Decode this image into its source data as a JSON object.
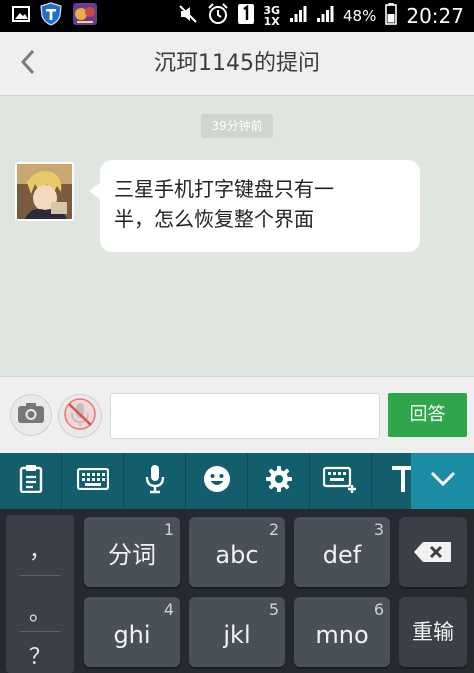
{
  "status_bar": {
    "net_top": "3G",
    "net_bottom": "1X",
    "battery": "48%",
    "time": "20:27"
  },
  "titlebar": {
    "title": "沉珂1145的提问"
  },
  "chat": {
    "time_label": "39分钟前",
    "message_line1": "三星手机打字键盘只有一",
    "message_line2": "半，怎么恢复整个界面"
  },
  "input_bar": {
    "answer_label": "回答",
    "text_value": ""
  },
  "keyboard": {
    "side_keys": [
      "，",
      "。",
      "？"
    ],
    "keys": [
      {
        "label": "分词",
        "num": "1"
      },
      {
        "label": "abc",
        "num": "2"
      },
      {
        "label": "def",
        "num": "3"
      },
      {
        "label": "ghi",
        "num": "4"
      },
      {
        "label": "jkl",
        "num": "5"
      },
      {
        "label": "mno",
        "num": "6"
      }
    ],
    "enter_label": "重输"
  },
  "colors": {
    "accent_green": "#2fa64b",
    "toolbar_teal": "#135e6c",
    "collapse_teal": "#1a8ca3",
    "chat_bg": "#dfe5df"
  },
  "icons": {
    "status_left": [
      "gallery-icon",
      "shield-app-icon",
      "game-app-icon"
    ],
    "status_right": [
      "mute-icon",
      "alarm-icon",
      "sim1-icon",
      "signal-icon",
      "battery-icon"
    ],
    "kb_toolbar": [
      "clipboard-icon",
      "keyboard-icon",
      "microphone-icon",
      "emoji-icon",
      "settings-icon",
      "keyboard-resize-icon",
      "text-icon",
      "chevron-down-icon"
    ]
  }
}
